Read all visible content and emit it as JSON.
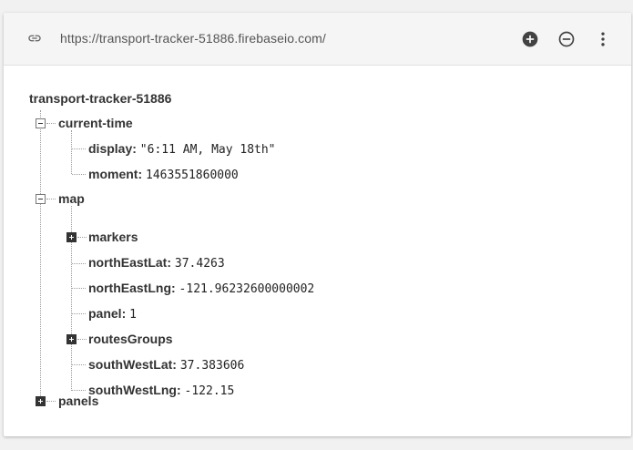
{
  "url": "https://transport-tracker-51886.firebaseio.com/",
  "root": "transport-tracker-51886",
  "tree": {
    "current_time": {
      "key": "current-time",
      "children": {
        "display": {
          "key": "display:",
          "value": "\"6:11 AM, May 18th\""
        },
        "moment": {
          "key": "moment:",
          "value": "1463551860000"
        }
      }
    },
    "map": {
      "key": "map",
      "children": {
        "markers": {
          "key": "markers"
        },
        "northEastLat": {
          "key": "northEastLat:",
          "value": "37.4263"
        },
        "northEastLng": {
          "key": "northEastLng:",
          "value": "-121.96232600000002"
        },
        "panel": {
          "key": "panel:",
          "value": "1"
        },
        "routesGroups": {
          "key": "routesGroups"
        },
        "southWestLat": {
          "key": "southWestLat:",
          "value": "37.383606"
        },
        "southWestLng": {
          "key": "southWestLng:",
          "value": "-122.15"
        }
      }
    },
    "panels": {
      "key": "panels"
    }
  },
  "icons": {
    "link": "link-icon",
    "add": "add-circle-icon",
    "remove": "remove-circle-outline-icon",
    "more": "more-vert-icon",
    "expand": "plus-box-icon",
    "collapse": "minus-box-icon"
  },
  "colors": {
    "header_bg": "#f5f5f5",
    "card_bg": "#ffffff",
    "page_bg": "#f1f1f1",
    "text": "#333333"
  }
}
